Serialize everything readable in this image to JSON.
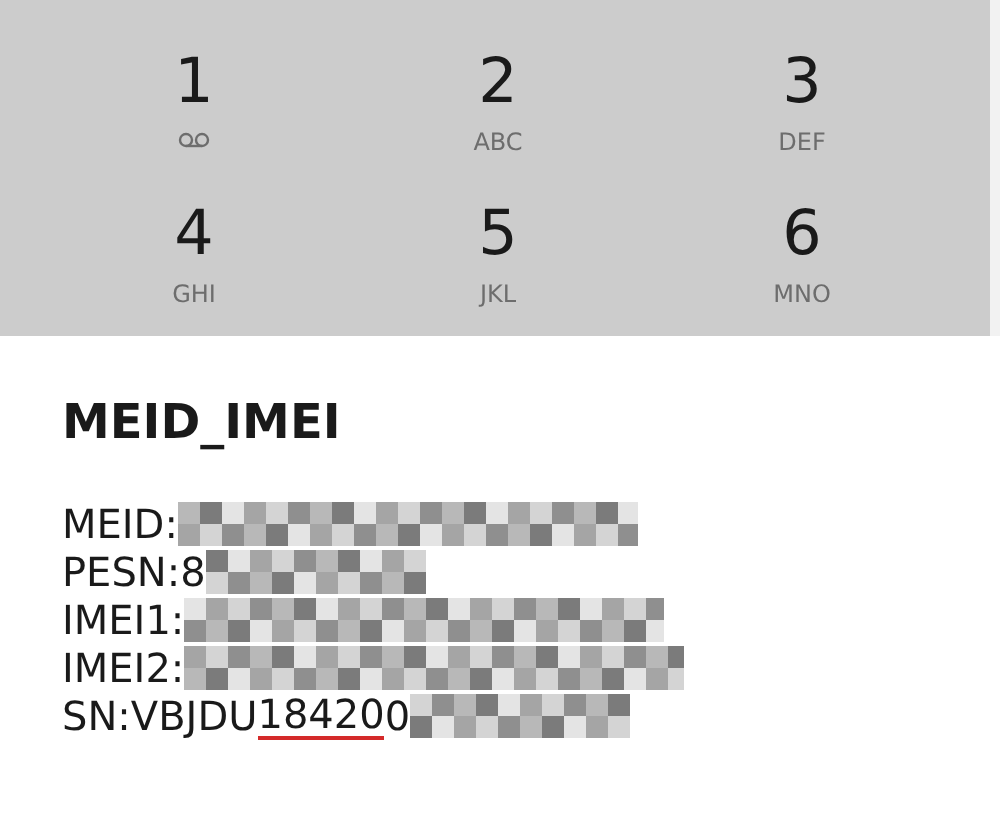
{
  "dialpad": {
    "keys": [
      {
        "digit": "1"
      },
      {
        "digit": "2",
        "letters": "ABC"
      },
      {
        "digit": "3",
        "letters": "DEF"
      },
      {
        "digit": "4",
        "letters": "GHI"
      },
      {
        "digit": "5",
        "letters": "JKL"
      },
      {
        "digit": "6",
        "letters": "MNO"
      }
    ]
  },
  "dialog": {
    "title": "MEID_IMEI",
    "lines": [
      {
        "label": "MEID:",
        "redacted": true
      },
      {
        "label": "PESN:8",
        "redacted": true
      },
      {
        "label": "IMEI1:",
        "redacted": true
      },
      {
        "label": "IMEI2:",
        "redacted": true
      },
      {
        "label": "SN:VBJDU",
        "underlined": "18420",
        "tail": "0",
        "redacted": true
      }
    ]
  }
}
